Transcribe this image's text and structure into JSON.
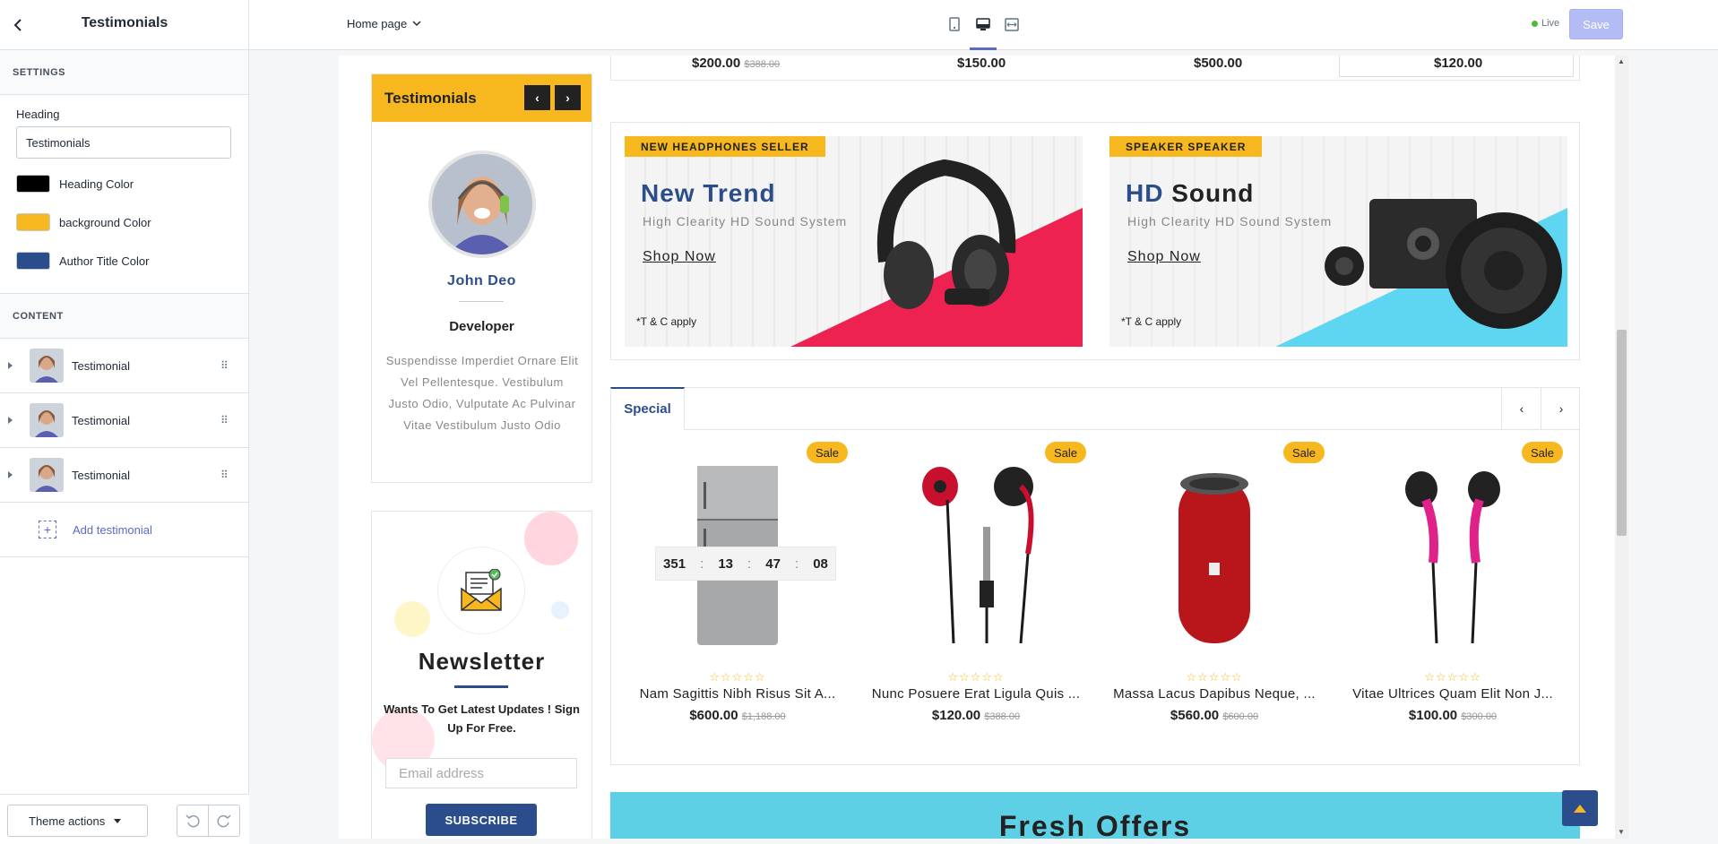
{
  "topbar": {
    "title": "Testimonials",
    "page_select": "Home page",
    "devices": [
      "mobile-icon",
      "desktop-icon",
      "fullwidth-icon"
    ],
    "live_label": "Live",
    "save_label": "Save"
  },
  "sidebar": {
    "settings_header": "SETTINGS",
    "heading_label": "Heading",
    "heading_value": "Testimonials",
    "colors": [
      {
        "label": "Heading Color",
        "value": "#000000"
      },
      {
        "label": "background Color",
        "value": "#f7b81f"
      },
      {
        "label": "Author Title Color",
        "value": "#2c4d8c"
      }
    ],
    "content_header": "CONTENT",
    "items": [
      {
        "label": "Testimonial"
      },
      {
        "label": "Testimonial"
      },
      {
        "label": "Testimonial"
      }
    ],
    "add_label": "Add testimonial",
    "theme_actions": "Theme actions"
  },
  "preview": {
    "top_prices": [
      {
        "price": "$200.00",
        "old": "$388.00"
      },
      {
        "price": "$150.00",
        "old": ""
      },
      {
        "price": "$500.00",
        "old": ""
      },
      {
        "price": "$120.00",
        "old": ""
      }
    ],
    "testimonial": {
      "heading": "Testimonials",
      "author": "John Deo",
      "role": "Developer",
      "quote": "Suspendisse Imperdiet Ornare Elit Vel Pellentesque. Vestibulum Justo Odio, Vulputate Ac Pulvinar Vitae Vestibulum Justo Odio"
    },
    "newsletter": {
      "title": "Newsletter",
      "desc": "Wants To Get Latest Updates ! Sign Up For Free.",
      "placeholder": "Email address",
      "button": "SUBSCRIBE"
    },
    "banners": [
      {
        "tag": "NEW HEADPHONES SELLER",
        "title_a": "New Trend",
        "title_b": "",
        "sub": "High Clearity HD Sound System",
        "shop": "Shop Now",
        "tc": "*T & C apply"
      },
      {
        "tag": "SPEAKER SPEAKER",
        "title_a": "HD",
        "title_b": "Sound",
        "sub": "High Clearity HD Sound System",
        "shop": "Shop Now",
        "tc": "*T & C apply"
      }
    ],
    "special": {
      "tab": "Special",
      "countdown": [
        "351",
        "13",
        "47",
        "08"
      ],
      "products": [
        {
          "sale": "Sale",
          "name": "Nam Sagittis Nibh Risus Sit A...",
          "price": "$600.00",
          "old": "$1,188.00"
        },
        {
          "sale": "Sale",
          "name": "Nunc Posuere Erat Ligula Quis ...",
          "price": "$120.00",
          "old": "$388.00"
        },
        {
          "sale": "Sale",
          "name": "Massa Lacus Dapibus Neque, ...",
          "price": "$560.00",
          "old": "$600.00"
        },
        {
          "sale": "Sale",
          "name": "Vitae Ultrices Quam Elit Non J...",
          "price": "$100.00",
          "old": "$300.00"
        }
      ],
      "stars": "☆☆☆☆☆"
    },
    "fresh_title": "Fresh Offers"
  }
}
